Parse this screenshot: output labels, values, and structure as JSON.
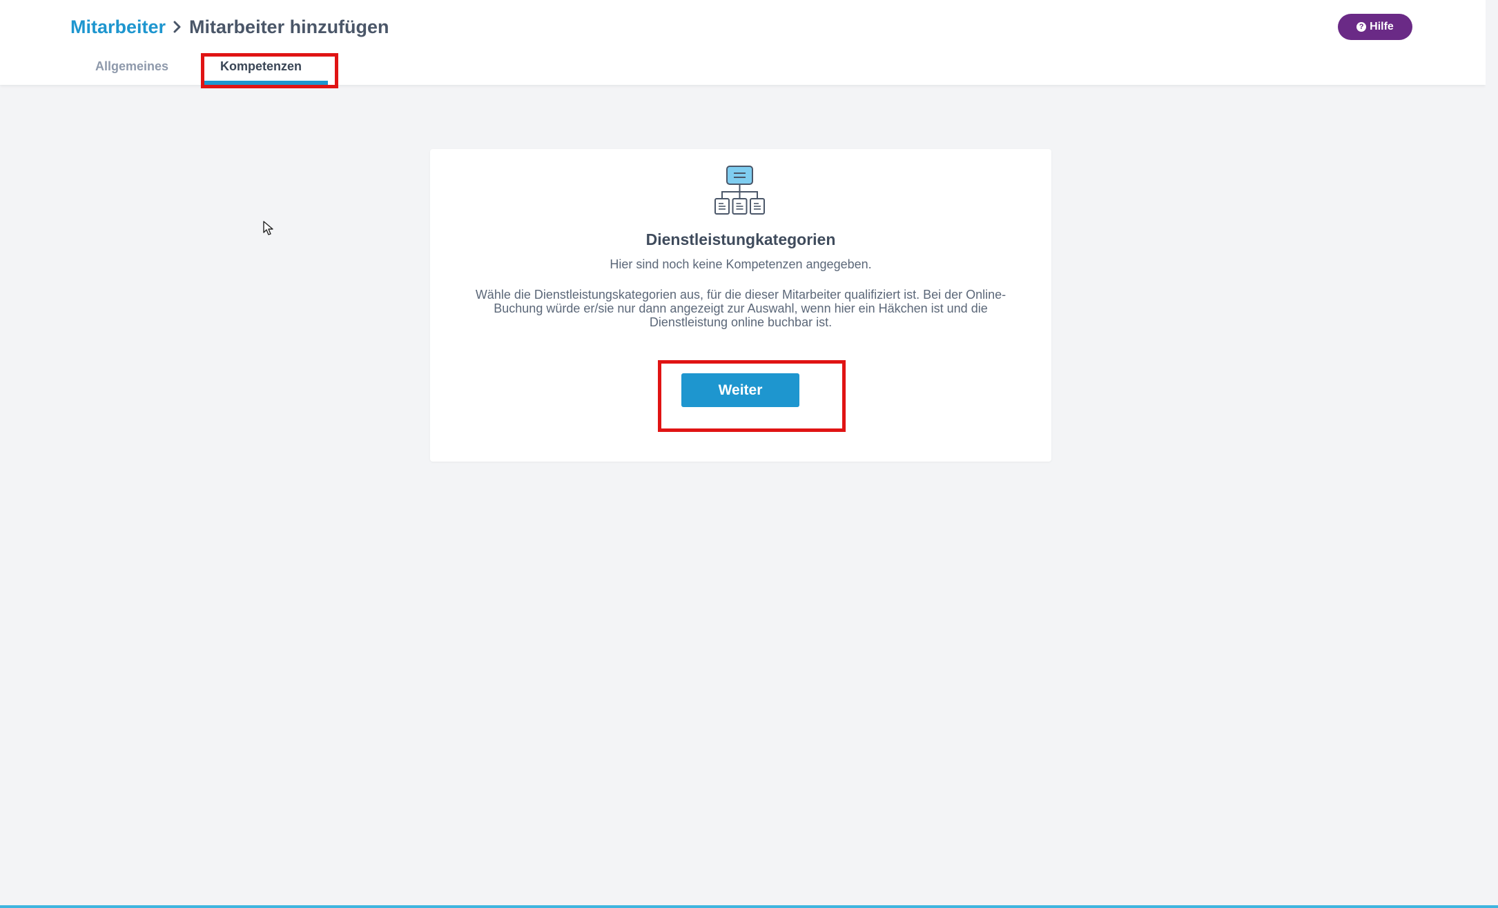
{
  "breadcrumb": {
    "parent": "Mitarbeiter",
    "current": "Mitarbeiter hinzufügen"
  },
  "help": {
    "label": "Hilfe",
    "icon": "question-circle-icon"
  },
  "tabs": [
    {
      "label": "Allgemeines",
      "active": false
    },
    {
      "label": "Kompetenzen",
      "active": true
    }
  ],
  "card": {
    "icon": "hierarchy-icon",
    "title": "Dienstleistungkategorien",
    "subtitle": "Hier sind noch keine Kompetenzen angegeben.",
    "description": "Wähle die Dienstleistungskategorien aus, für die dieser Mitarbeiter qualifiziert ist. Bei der Online-Buchung würde er/sie nur dann angezeigt zur Auswahl, wenn hier ein Häkchen ist und die Dienstleistung online buchbar ist.",
    "next_label": "Weiter"
  },
  "colors": {
    "accent": "#1e96cf",
    "help": "#6a2a86",
    "highlight": "#e01414",
    "background": "#f3f4f6"
  }
}
